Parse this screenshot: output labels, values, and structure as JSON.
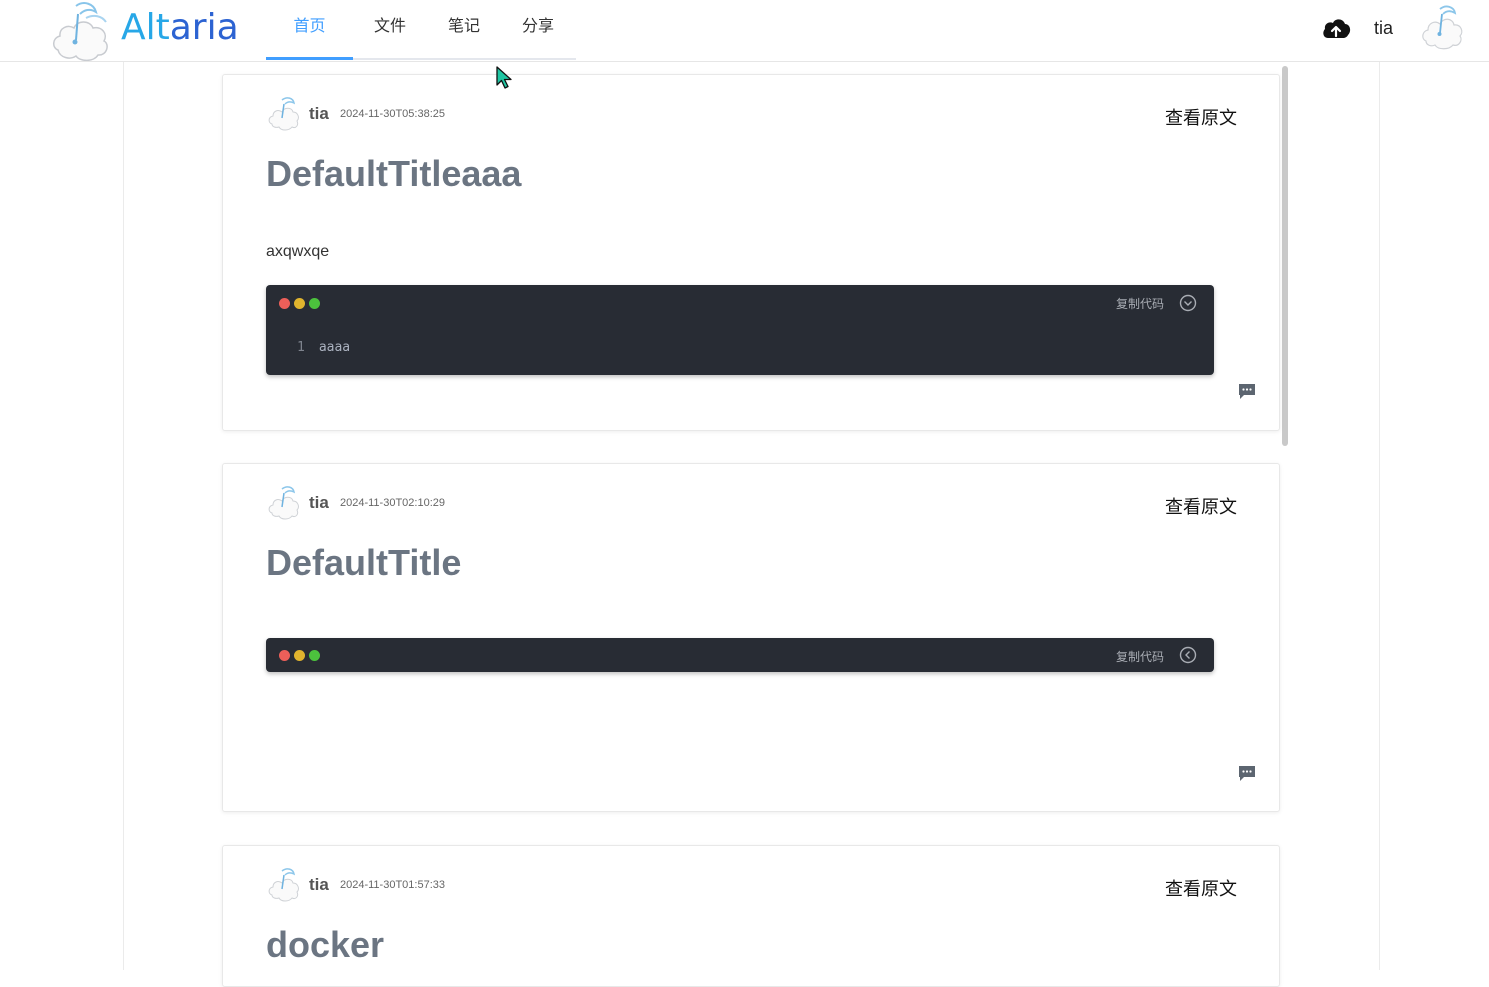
{
  "app": {
    "logo_text_a": "Alt",
    "logo_text_b": "aria"
  },
  "nav": {
    "items": [
      {
        "label": "首页",
        "active": true
      },
      {
        "label": "文件",
        "active": false
      },
      {
        "label": "笔记",
        "active": false
      },
      {
        "label": "分享",
        "active": false
      }
    ]
  },
  "header": {
    "upload_icon": "cloud-upload-icon",
    "username": "tia"
  },
  "posts": [
    {
      "author": "tia",
      "timestamp": "2024-11-30T05:38:25",
      "view_original": "查看原文",
      "title": "DefaultTitleaaa",
      "body": "axqwxqe",
      "code": {
        "copy_label": "复制代码",
        "toggle_icon": "chevron-down-circle-icon",
        "lines": [
          {
            "num": "1",
            "text": "aaaa"
          }
        ]
      }
    },
    {
      "author": "tia",
      "timestamp": "2024-11-30T02:10:29",
      "view_original": "查看原文",
      "title": "DefaultTitle",
      "code": {
        "copy_label": "复制代码",
        "toggle_icon": "chevron-left-circle-icon"
      }
    },
    {
      "author": "tia",
      "timestamp": "2024-11-30T01:57:33",
      "view_original": "查看原文",
      "title": "docker"
    }
  ],
  "colors": {
    "accent": "#409eff",
    "title": "#6b7582",
    "code_bg": "#282c34"
  }
}
